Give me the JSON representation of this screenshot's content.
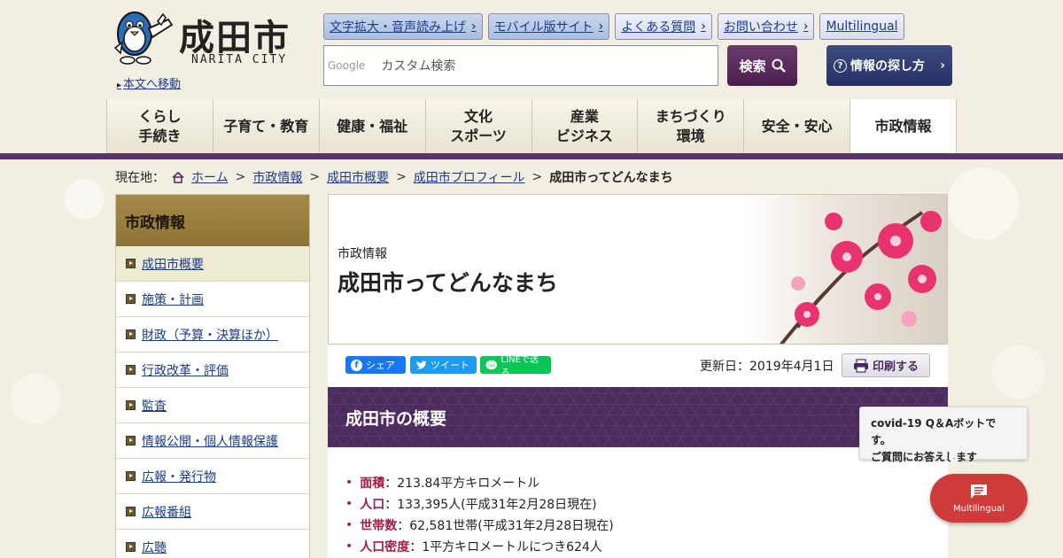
{
  "header": {
    "logo_kanji": "成田市",
    "logo_roman": "NARITA CITY",
    "skip_link": "本文へ移動",
    "top_links": [
      {
        "label": "文字拡大・音声読み上げ"
      },
      {
        "label": "モバイル版サイト"
      },
      {
        "label": "よくある質問"
      },
      {
        "label": "お問い合わせ"
      },
      {
        "label": "Multilingual"
      }
    ],
    "search": {
      "provider": "Google",
      "placeholder": "カスタム検索",
      "button": "検索"
    },
    "info_button": "情報の探し方"
  },
  "nav": [
    {
      "line1": "くらし",
      "line2": "手続き"
    },
    {
      "line1": "子育て・教育",
      "line2": ""
    },
    {
      "line1": "健康・福祉",
      "line2": ""
    },
    {
      "line1": "文化",
      "line2": "スポーツ"
    },
    {
      "line1": "産業",
      "line2": "ビジネス"
    },
    {
      "line1": "まちづくり",
      "line2": "環境"
    },
    {
      "line1": "安全・安心",
      "line2": ""
    },
    {
      "line1": "市政情報",
      "line2": ""
    }
  ],
  "breadcrumb": {
    "label": "現在地：",
    "items": [
      "ホーム",
      "市政情報",
      "成田市概要",
      "成田市プロフィール"
    ],
    "current": "成田市ってどんなまち"
  },
  "sidebar": {
    "title": "市政情報",
    "items": [
      "成田市概要",
      "施策・計画",
      "財政（予算・決算ほか）",
      "行政改革・評価",
      "監査",
      "情報公開・個人情報保護",
      "広報・発行物",
      "広報番組",
      "広聴"
    ]
  },
  "page": {
    "category": "市政情報",
    "title": "成田市ってどんなまち",
    "share": {
      "facebook": "シェア",
      "twitter": "ツイート",
      "line": "LINEで送る"
    },
    "updated": "更新日：2019年4月1日",
    "print": "印刷する",
    "section_title": "成田市の概要",
    "facts": [
      {
        "label": "面積",
        "value": "：213.84平方キロメートル"
      },
      {
        "label": "人口",
        "value": "：133,395人(平成31年2月28日現在)"
      },
      {
        "label": "世帯数",
        "value": "：62,581世帯(平成31年2月28日現在)"
      },
      {
        "label": "人口密度",
        "value": "：1平方キロメートルにつき624人"
      }
    ]
  },
  "chatbot": {
    "line1": "covid-19 Q＆Aボットです。",
    "line2": "ご質問にお答えします",
    "button": "Multilingual"
  },
  "colors": {
    "purple": "#5c3366",
    "gold": "#9c8240",
    "red": "#cf3b3b"
  }
}
